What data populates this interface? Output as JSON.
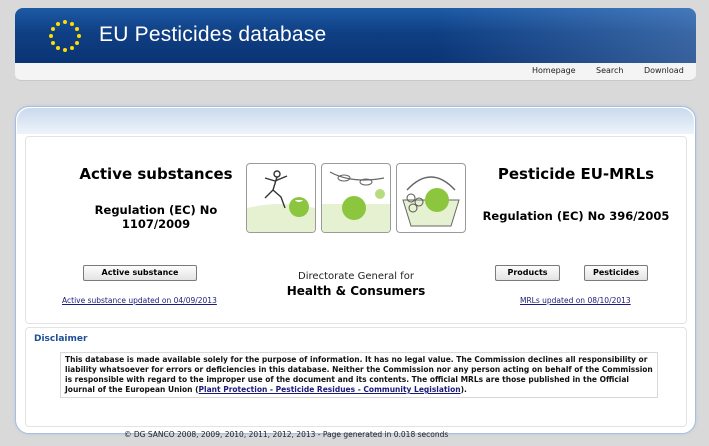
{
  "util_links": [
    "",
    ""
  ],
  "header": {
    "title": "EU Pesticides database"
  },
  "nav": {
    "homepage": "Homepage",
    "search": "Search",
    "download": "Download"
  },
  "left": {
    "heading": "Active substances",
    "regulation": "Regulation (EC) No 1107/2009",
    "button": "Active substance",
    "update_link": "Active substance updated on 04/09/2013"
  },
  "center": {
    "dg_small": "Directorate General for",
    "dg_big": "Health & Consumers"
  },
  "right": {
    "heading": "Pesticide EU-MRLs",
    "regulation": "Regulation (EC) No 396/2005",
    "button_products": "Products",
    "button_pesticides": "Pesticides",
    "update_link": "MRLs updated on 08/10/2013"
  },
  "disclaimer": {
    "title": "Disclaimer",
    "text": "This database is made available solely for the purpose of information. It has no legal value. The Commission declines all responsibility or liability whatsoever for errors or deficiencies in this database. Neither the Commission nor any person acting on behalf of the Commission is responsible with regard to the improper use of the document and its contents. The official MRLs are those published in the Official Journal of the European Union (",
    "link": "Plant Protection - Pesticide Residues - Community Legislation",
    "text_end": ")."
  },
  "footer": "© DG SANCO 2008, 2009, 2010, 2011, 2012, 2013 - Page generated in 0.018 seconds",
  "colors": {
    "banner": "#0f3f83",
    "disclaimer_title": "#1e4f94",
    "illustration_green": "#8cc63f"
  }
}
